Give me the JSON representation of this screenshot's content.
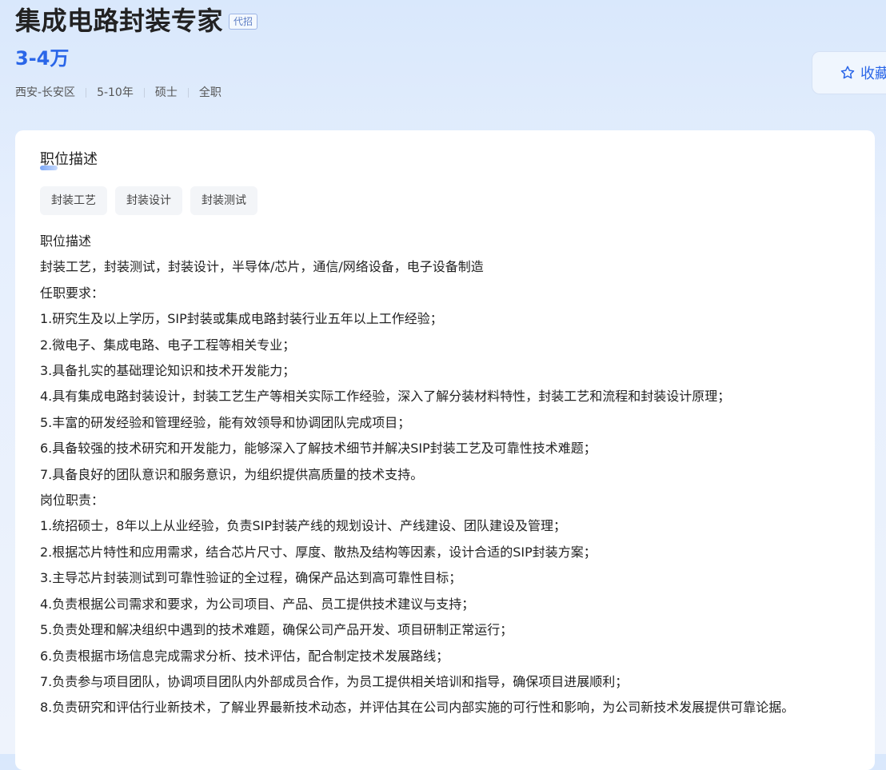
{
  "job": {
    "title": "集成电路封装专家",
    "badge": "代招",
    "salary": "3-4万",
    "location": "西安-长安区",
    "experience": "5-10年",
    "education": "硕士",
    "type": "全职"
  },
  "favorite": {
    "icon": "star-outline-icon",
    "label": "收藏"
  },
  "colors": {
    "accent": "#2a66e8",
    "background": "#e6effd",
    "tag_bg": "#f3f5f8"
  },
  "description": {
    "section_title": "职位描述",
    "tags": [
      "封装工艺",
      "封装设计",
      "封装测试"
    ],
    "lines": [
      "职位描述",
      "封装工艺，封装测试，封装设计，半导体/芯片，通信/网络设备，电子设备制造",
      "任职要求：",
      "1.研究生及以上学历，SIP封装或集成电路封装行业五年以上工作经验；",
      "2.微电子、集成电路、电子工程等相关专业；",
      "3.具备扎实的基础理论知识和技术开发能力；",
      "4.具有集成电路封装设计，封装工艺生产等相关实际工作经验，深入了解分装材料特性，封装工艺和流程和封装设计原理；",
      "5.丰富的研发经验和管理经验，能有效领导和协调团队完成项目；",
      "6.具备较强的技术研究和开发能力，能够深入了解技术细节并解决SIP封装工艺及可靠性技术难题；",
      "7.具备良好的团队意识和服务意识，为组织提供高质量的技术支持。",
      "岗位职责：",
      "1.统招硕士，8年以上从业经验，负责SIP封装产线的规划设计、产线建设、团队建设及管理；",
      "2.根据芯片特性和应用需求，结合芯片尺寸、厚度、散热及结构等因素，设计合适的SIP封装方案；",
      "3.主导芯片封装测试到可靠性验证的全过程，确保产品达到高可靠性目标；",
      "4.负责根据公司需求和要求，为公司项目、产品、员工提供技术建议与支持；",
      "5.负责处理和解决组织中遇到的技术难题，确保公司产品开发、项目研制正常运行；",
      "6.负责根据市场信息完成需求分析、技术评估，配合制定技术发展路线；",
      "7.负责参与项目团队，协调项目团队内外部成员合作，为员工提供相关培训和指导，确保项目进展顺利；",
      "8.负责研究和评估行业新技术，了解业界最新技术动态，并评估其在公司内部实施的可行性和影响，为公司新技术发展提供可靠论据。"
    ]
  }
}
